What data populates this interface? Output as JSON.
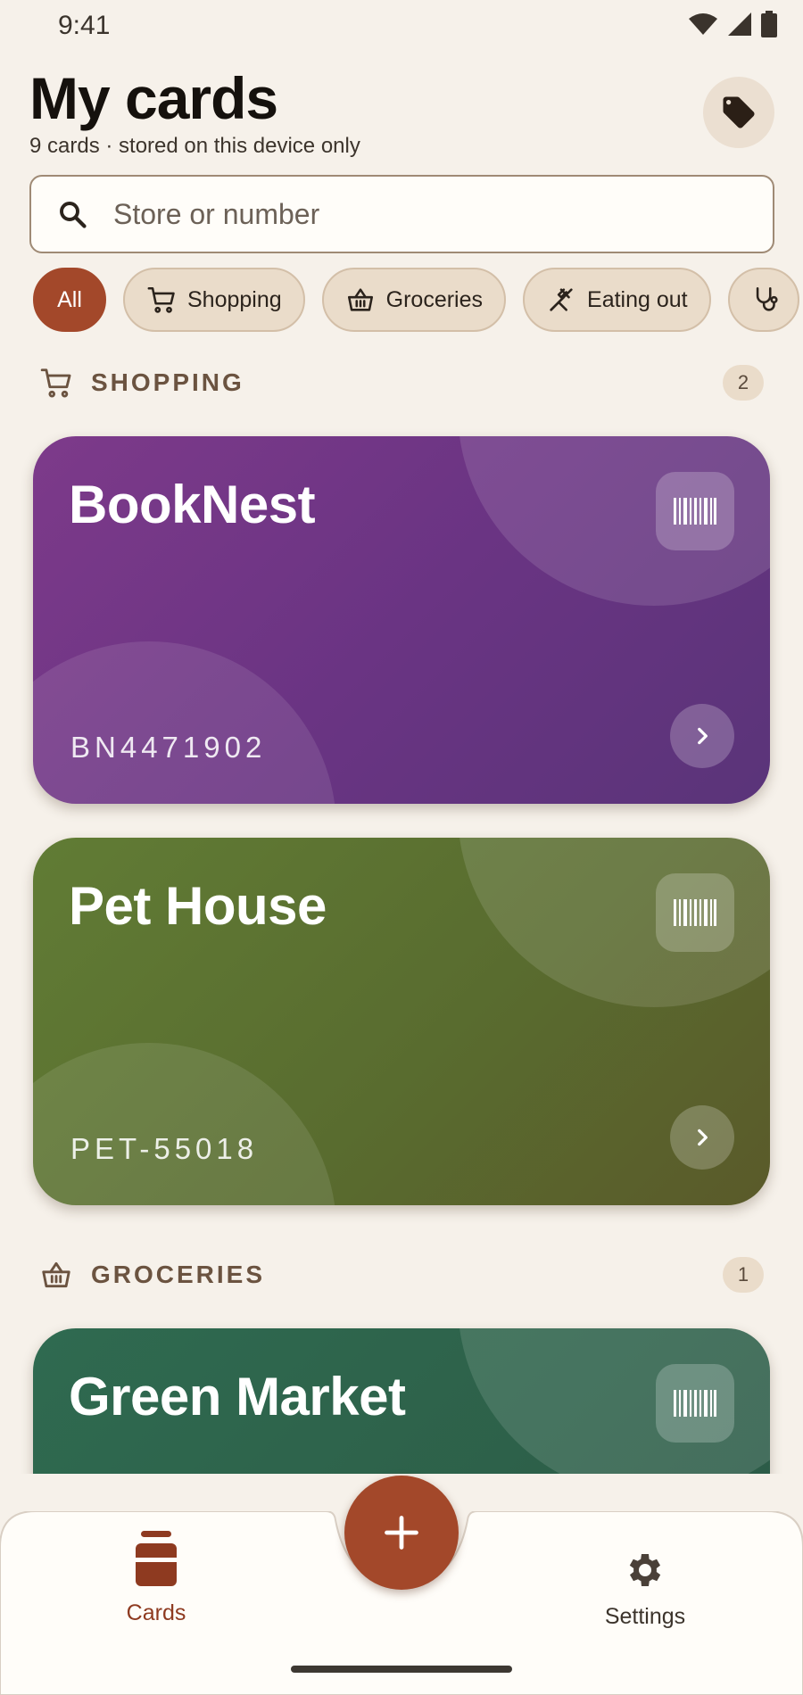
{
  "status": {
    "time": "9:41"
  },
  "header": {
    "title": "My cards",
    "subtitle": "9 cards · stored on this device only",
    "tag_icon": "tag-icon"
  },
  "search": {
    "placeholder": "Store or number",
    "value": ""
  },
  "chips": [
    {
      "label": "All",
      "icon": "",
      "active": true
    },
    {
      "label": "Shopping",
      "icon": "cart-icon",
      "active": false
    },
    {
      "label": "Groceries",
      "icon": "basket-icon",
      "active": false
    },
    {
      "label": "Eating out",
      "icon": "utensils-off-icon",
      "active": false
    },
    {
      "label": "",
      "icon": "stethoscope-icon",
      "active": false
    }
  ],
  "sections": [
    {
      "label": "SHOPPING",
      "count": "2",
      "icon": "cart-icon",
      "cards": [
        {
          "name": "BookNest",
          "number": "BN4471902",
          "color": "#6a3483"
        },
        {
          "name": "Pet House",
          "number": "PET-55018",
          "color": "#5b6c2f"
        }
      ]
    },
    {
      "label": "GROCERIES",
      "count": "1",
      "icon": "basket-icon",
      "cards": [
        {
          "name": "Green Market",
          "number": "",
          "color": "#2d6049"
        }
      ]
    }
  ],
  "nav": {
    "cards_label": "Cards",
    "settings_label": "Settings"
  },
  "colors": {
    "accent": "#a3482a",
    "background": "#f6f1ea"
  }
}
